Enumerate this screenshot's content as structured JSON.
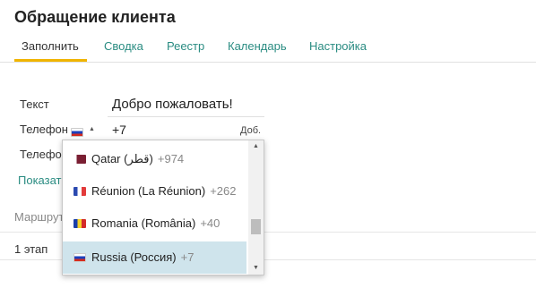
{
  "page_title": "Обращение клиента",
  "tabs": [
    {
      "label": "Заполнить",
      "active": true
    },
    {
      "label": "Сводка",
      "active": false
    },
    {
      "label": "Реестр",
      "active": false
    },
    {
      "label": "Календарь",
      "active": false
    },
    {
      "label": "Настройка",
      "active": false
    }
  ],
  "form": {
    "text_label": "Текст",
    "text_value": "Добро пожаловать!",
    "phone_label": "Телефон",
    "phone_value": "+7",
    "phone_ext": "Доб.",
    "phone2_label": "Телефон",
    "show_link": "Показать",
    "route_label": "Маршрут",
    "stage_label": "1 этап"
  },
  "country_dropdown": {
    "options": [
      {
        "name": "Qatar (قطر)",
        "code": "+974",
        "flag": "flag-qatar"
      },
      {
        "name": "Réunion (La Réunion)",
        "code": "+262",
        "flag": "flag-france"
      },
      {
        "name": "Romania (România)",
        "code": "+40",
        "flag": "flag-romania"
      },
      {
        "name": "Russia (Россия)",
        "code": "+7",
        "flag": "flag-russia",
        "selected": true
      }
    ]
  },
  "colors": {
    "accent": "#2a8c82",
    "tab_underline": "#f0b400",
    "selected_option": "#cfe4ec"
  }
}
